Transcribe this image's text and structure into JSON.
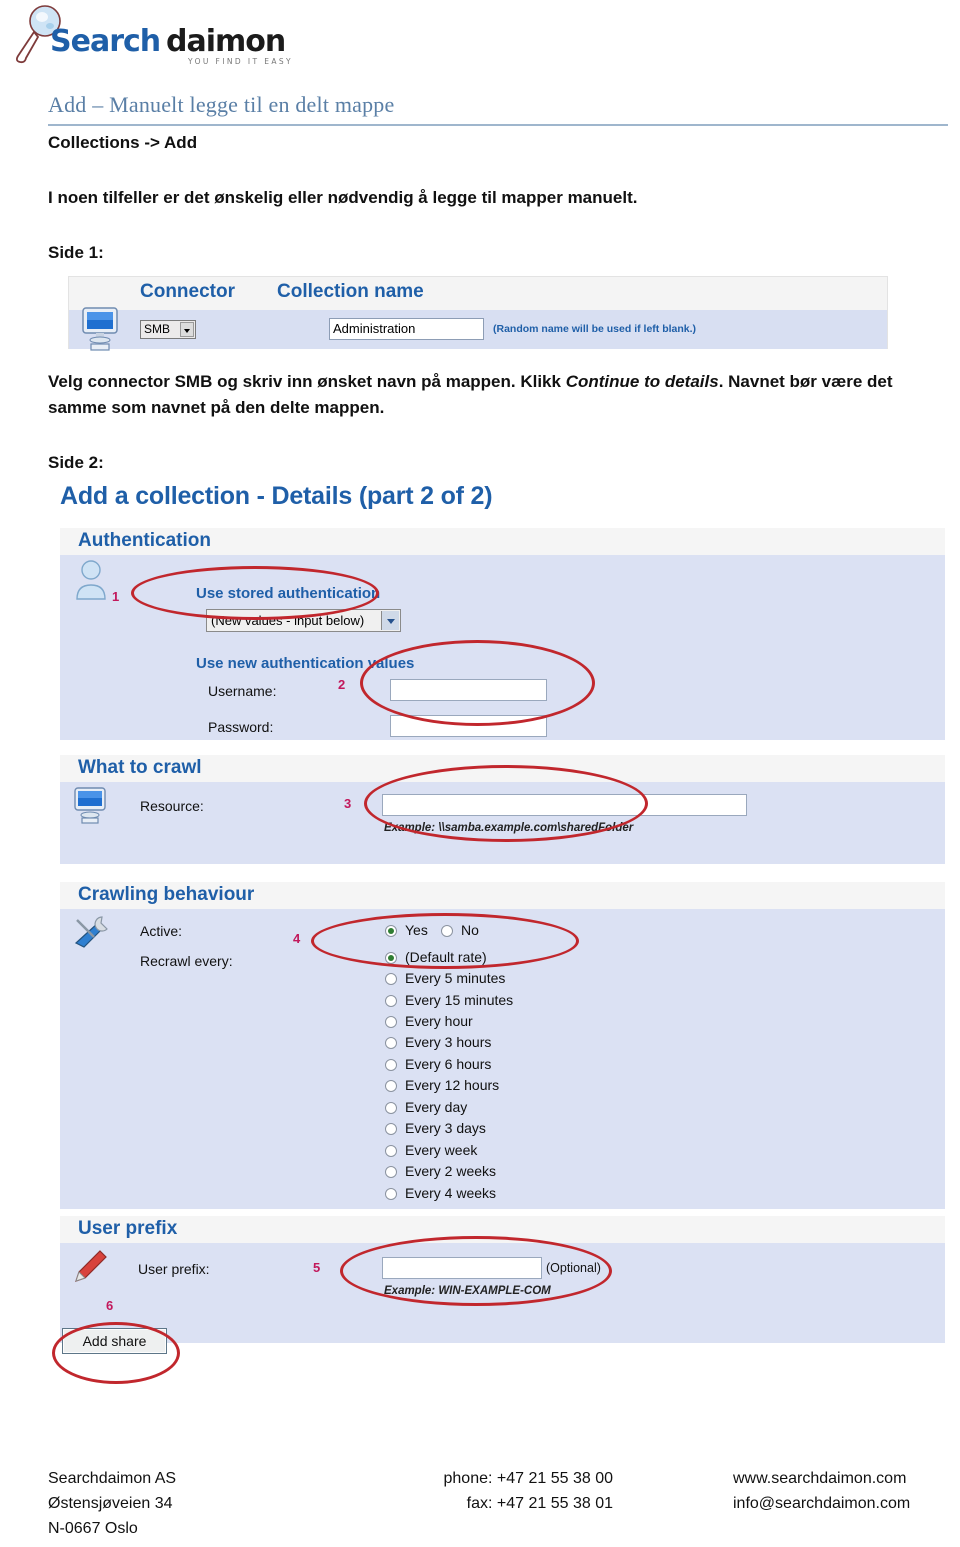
{
  "logo": {
    "brand_part1": "Search",
    "brand_part2": "daimon",
    "tagline": "Y O U  F I N D  I T  E A S Y",
    "colors": {
      "blue": "#1f5fa8",
      "dark": "#1b1b1b",
      "accent_red": "#c1272d"
    }
  },
  "document": {
    "title": "Add – Manuelt legge til en delt mappe",
    "breadcrumb": "Collections -> Add",
    "intro": "I noen tilfeller er det ønskelig eller nødvendig å legge til mapper manuelt.",
    "side1_label": "Side 1:",
    "explain_before": "Velg connector SMB og skriv inn ønsket navn på mappen. Klikk ",
    "explain_italic": "Continue to details",
    "explain_after": ". Navnet bør være det samme som navnet på den delte mappen.",
    "side2_label": "Side 2:"
  },
  "screenshot1": {
    "header_connector": "Connector",
    "header_collection_name": "Collection name",
    "connector_value": "SMB",
    "collection_name_value": "Administration",
    "collection_name_hint": "(Random name will be used if left blank.)"
  },
  "screenshot2": {
    "title": "Add a collection - Details (part 2 of 2)",
    "authentication": {
      "section_title": "Authentication",
      "use_stored_label": "Use stored authentication",
      "stored_select_value": "(New values - input below)",
      "use_new_label": "Use new authentication values",
      "username_label": "Username:",
      "username_value": "",
      "password_label": "Password:",
      "password_value": ""
    },
    "what_to_crawl": {
      "section_title": "What to crawl",
      "resource_label": "Resource:",
      "resource_value": "",
      "resource_example": "Example: \\\\samba.example.com\\sharedFolder"
    },
    "crawling_behaviour": {
      "section_title": "Crawling behaviour",
      "active_label": "Active:",
      "active_yes": "Yes",
      "active_no": "No",
      "active_selected": "Yes",
      "recrawl_label": "Recrawl every:",
      "recrawl_selected": "(Default rate)",
      "recrawl_options": [
        "(Default rate)",
        "Every 5 minutes",
        "Every 15 minutes",
        "Every hour",
        "Every 3 hours",
        "Every 6 hours",
        "Every 12 hours",
        "Every day",
        "Every 3 days",
        "Every week",
        "Every 2 weeks",
        "Every 4 weeks"
      ]
    },
    "user_prefix": {
      "section_title": "User prefix",
      "label": "User prefix:",
      "value": "",
      "optional": "(Optional)",
      "example": "Example: WIN-EXAMPLE-COM"
    },
    "submit_button": "Add share",
    "callouts": [
      "1",
      "2",
      "3",
      "4",
      "5",
      "6"
    ]
  },
  "footer": {
    "company": "Searchdaimon AS",
    "street": "Østensjøveien 34",
    "city": "N-0667 Oslo",
    "phone": "phone: +47 21 55 38 00",
    "fax": "fax: +47 21 55 38 01",
    "web": "www.searchdaimon.com",
    "email": "info@searchdaimon.com"
  }
}
